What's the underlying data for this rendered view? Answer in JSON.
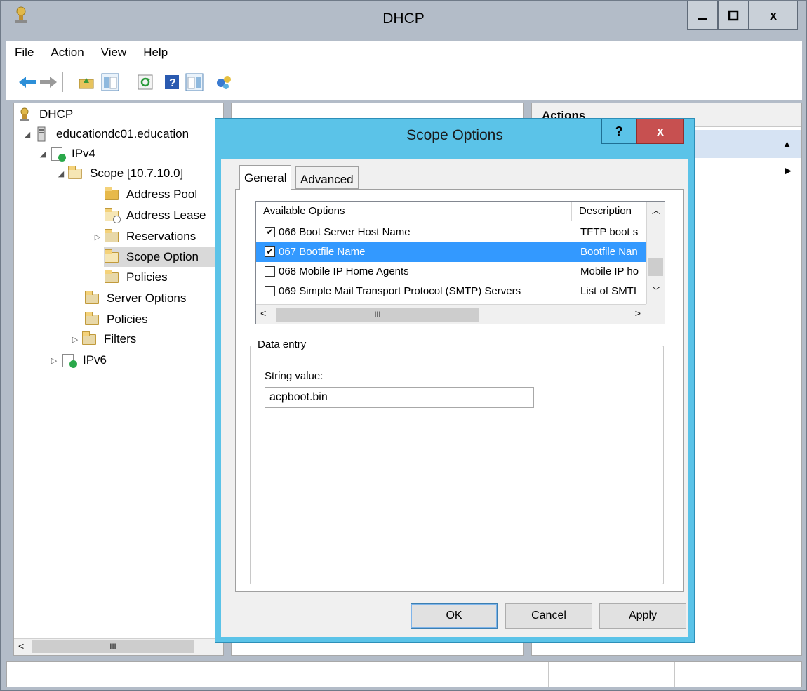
{
  "window": {
    "title": "DHCP",
    "minimize_label": "‒",
    "maximize_label": "□",
    "close_label": "x"
  },
  "menu": [
    "File",
    "Action",
    "View",
    "Help"
  ],
  "toolbar": {
    "icons": [
      "back-icon",
      "forward-icon",
      "up-folder-icon",
      "show-hide-tree-icon",
      "refresh-icon",
      "help-icon",
      "properties-icon",
      "connect-icon"
    ]
  },
  "tree": {
    "root": "DHCP",
    "server": "educationdc01.education",
    "ipv4": "IPv4",
    "scope": "Scope [10.7.10.0]",
    "address_pool": "Address Pool",
    "address_leases": "Address Lease",
    "reservations": "Reservations",
    "scope_options": "Scope Option",
    "scope_policies": "Policies",
    "server_options": "Server Options",
    "policies": "Policies",
    "filters": "Filters",
    "ipv6": "IPv6"
  },
  "actions": {
    "header": "Actions"
  },
  "dialog": {
    "title": "Scope Options",
    "help_label": "?",
    "close_label": "x",
    "tabs": [
      "General",
      "Advanced"
    ],
    "list_headers": {
      "available": "Available Options",
      "description": "Description"
    },
    "options": [
      {
        "checked": true,
        "name": "066 Boot Server Host Name",
        "desc": "TFTP boot s"
      },
      {
        "checked": true,
        "name": "067 Bootfile Name",
        "desc": "Bootfile Nan",
        "selected": true
      },
      {
        "checked": false,
        "name": "068 Mobile IP Home Agents",
        "desc": "Mobile IP ho"
      },
      {
        "checked": false,
        "name": "069 Simple Mail Transport Protocol (SMTP) Servers",
        "desc": "List of SMTI"
      }
    ],
    "scroll_thumb_glyph": "III",
    "data_entry_legend": "Data entry",
    "string_label": "String value:",
    "string_value": "acpboot.bin",
    "ok_label": "OK",
    "cancel_label": "Cancel",
    "apply_label": "Apply"
  },
  "tree_scroll_glyph": "III"
}
